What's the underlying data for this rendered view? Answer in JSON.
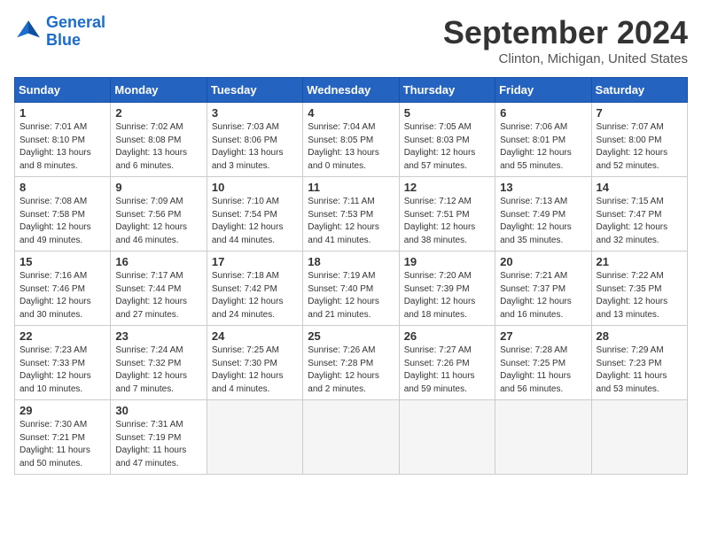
{
  "header": {
    "logo_line1": "General",
    "logo_line2": "Blue",
    "month": "September 2024",
    "location": "Clinton, Michigan, United States"
  },
  "weekdays": [
    "Sunday",
    "Monday",
    "Tuesday",
    "Wednesday",
    "Thursday",
    "Friday",
    "Saturday"
  ],
  "weeks": [
    [
      {
        "day": "1",
        "info": "Sunrise: 7:01 AM\nSunset: 8:10 PM\nDaylight: 13 hours\nand 8 minutes."
      },
      {
        "day": "2",
        "info": "Sunrise: 7:02 AM\nSunset: 8:08 PM\nDaylight: 13 hours\nand 6 minutes."
      },
      {
        "day": "3",
        "info": "Sunrise: 7:03 AM\nSunset: 8:06 PM\nDaylight: 13 hours\nand 3 minutes."
      },
      {
        "day": "4",
        "info": "Sunrise: 7:04 AM\nSunset: 8:05 PM\nDaylight: 13 hours\nand 0 minutes."
      },
      {
        "day": "5",
        "info": "Sunrise: 7:05 AM\nSunset: 8:03 PM\nDaylight: 12 hours\nand 57 minutes."
      },
      {
        "day": "6",
        "info": "Sunrise: 7:06 AM\nSunset: 8:01 PM\nDaylight: 12 hours\nand 55 minutes."
      },
      {
        "day": "7",
        "info": "Sunrise: 7:07 AM\nSunset: 8:00 PM\nDaylight: 12 hours\nand 52 minutes."
      }
    ],
    [
      {
        "day": "8",
        "info": "Sunrise: 7:08 AM\nSunset: 7:58 PM\nDaylight: 12 hours\nand 49 minutes."
      },
      {
        "day": "9",
        "info": "Sunrise: 7:09 AM\nSunset: 7:56 PM\nDaylight: 12 hours\nand 46 minutes."
      },
      {
        "day": "10",
        "info": "Sunrise: 7:10 AM\nSunset: 7:54 PM\nDaylight: 12 hours\nand 44 minutes."
      },
      {
        "day": "11",
        "info": "Sunrise: 7:11 AM\nSunset: 7:53 PM\nDaylight: 12 hours\nand 41 minutes."
      },
      {
        "day": "12",
        "info": "Sunrise: 7:12 AM\nSunset: 7:51 PM\nDaylight: 12 hours\nand 38 minutes."
      },
      {
        "day": "13",
        "info": "Sunrise: 7:13 AM\nSunset: 7:49 PM\nDaylight: 12 hours\nand 35 minutes."
      },
      {
        "day": "14",
        "info": "Sunrise: 7:15 AM\nSunset: 7:47 PM\nDaylight: 12 hours\nand 32 minutes."
      }
    ],
    [
      {
        "day": "15",
        "info": "Sunrise: 7:16 AM\nSunset: 7:46 PM\nDaylight: 12 hours\nand 30 minutes."
      },
      {
        "day": "16",
        "info": "Sunrise: 7:17 AM\nSunset: 7:44 PM\nDaylight: 12 hours\nand 27 minutes."
      },
      {
        "day": "17",
        "info": "Sunrise: 7:18 AM\nSunset: 7:42 PM\nDaylight: 12 hours\nand 24 minutes."
      },
      {
        "day": "18",
        "info": "Sunrise: 7:19 AM\nSunset: 7:40 PM\nDaylight: 12 hours\nand 21 minutes."
      },
      {
        "day": "19",
        "info": "Sunrise: 7:20 AM\nSunset: 7:39 PM\nDaylight: 12 hours\nand 18 minutes."
      },
      {
        "day": "20",
        "info": "Sunrise: 7:21 AM\nSunset: 7:37 PM\nDaylight: 12 hours\nand 16 minutes."
      },
      {
        "day": "21",
        "info": "Sunrise: 7:22 AM\nSunset: 7:35 PM\nDaylight: 12 hours\nand 13 minutes."
      }
    ],
    [
      {
        "day": "22",
        "info": "Sunrise: 7:23 AM\nSunset: 7:33 PM\nDaylight: 12 hours\nand 10 minutes."
      },
      {
        "day": "23",
        "info": "Sunrise: 7:24 AM\nSunset: 7:32 PM\nDaylight: 12 hours\nand 7 minutes."
      },
      {
        "day": "24",
        "info": "Sunrise: 7:25 AM\nSunset: 7:30 PM\nDaylight: 12 hours\nand 4 minutes."
      },
      {
        "day": "25",
        "info": "Sunrise: 7:26 AM\nSunset: 7:28 PM\nDaylight: 12 hours\nand 2 minutes."
      },
      {
        "day": "26",
        "info": "Sunrise: 7:27 AM\nSunset: 7:26 PM\nDaylight: 11 hours\nand 59 minutes."
      },
      {
        "day": "27",
        "info": "Sunrise: 7:28 AM\nSunset: 7:25 PM\nDaylight: 11 hours\nand 56 minutes."
      },
      {
        "day": "28",
        "info": "Sunrise: 7:29 AM\nSunset: 7:23 PM\nDaylight: 11 hours\nand 53 minutes."
      }
    ],
    [
      {
        "day": "29",
        "info": "Sunrise: 7:30 AM\nSunset: 7:21 PM\nDaylight: 11 hours\nand 50 minutes."
      },
      {
        "day": "30",
        "info": "Sunrise: 7:31 AM\nSunset: 7:19 PM\nDaylight: 11 hours\nand 47 minutes."
      },
      {
        "day": "",
        "info": "",
        "empty": true
      },
      {
        "day": "",
        "info": "",
        "empty": true
      },
      {
        "day": "",
        "info": "",
        "empty": true
      },
      {
        "day": "",
        "info": "",
        "empty": true
      },
      {
        "day": "",
        "info": "",
        "empty": true
      }
    ]
  ]
}
